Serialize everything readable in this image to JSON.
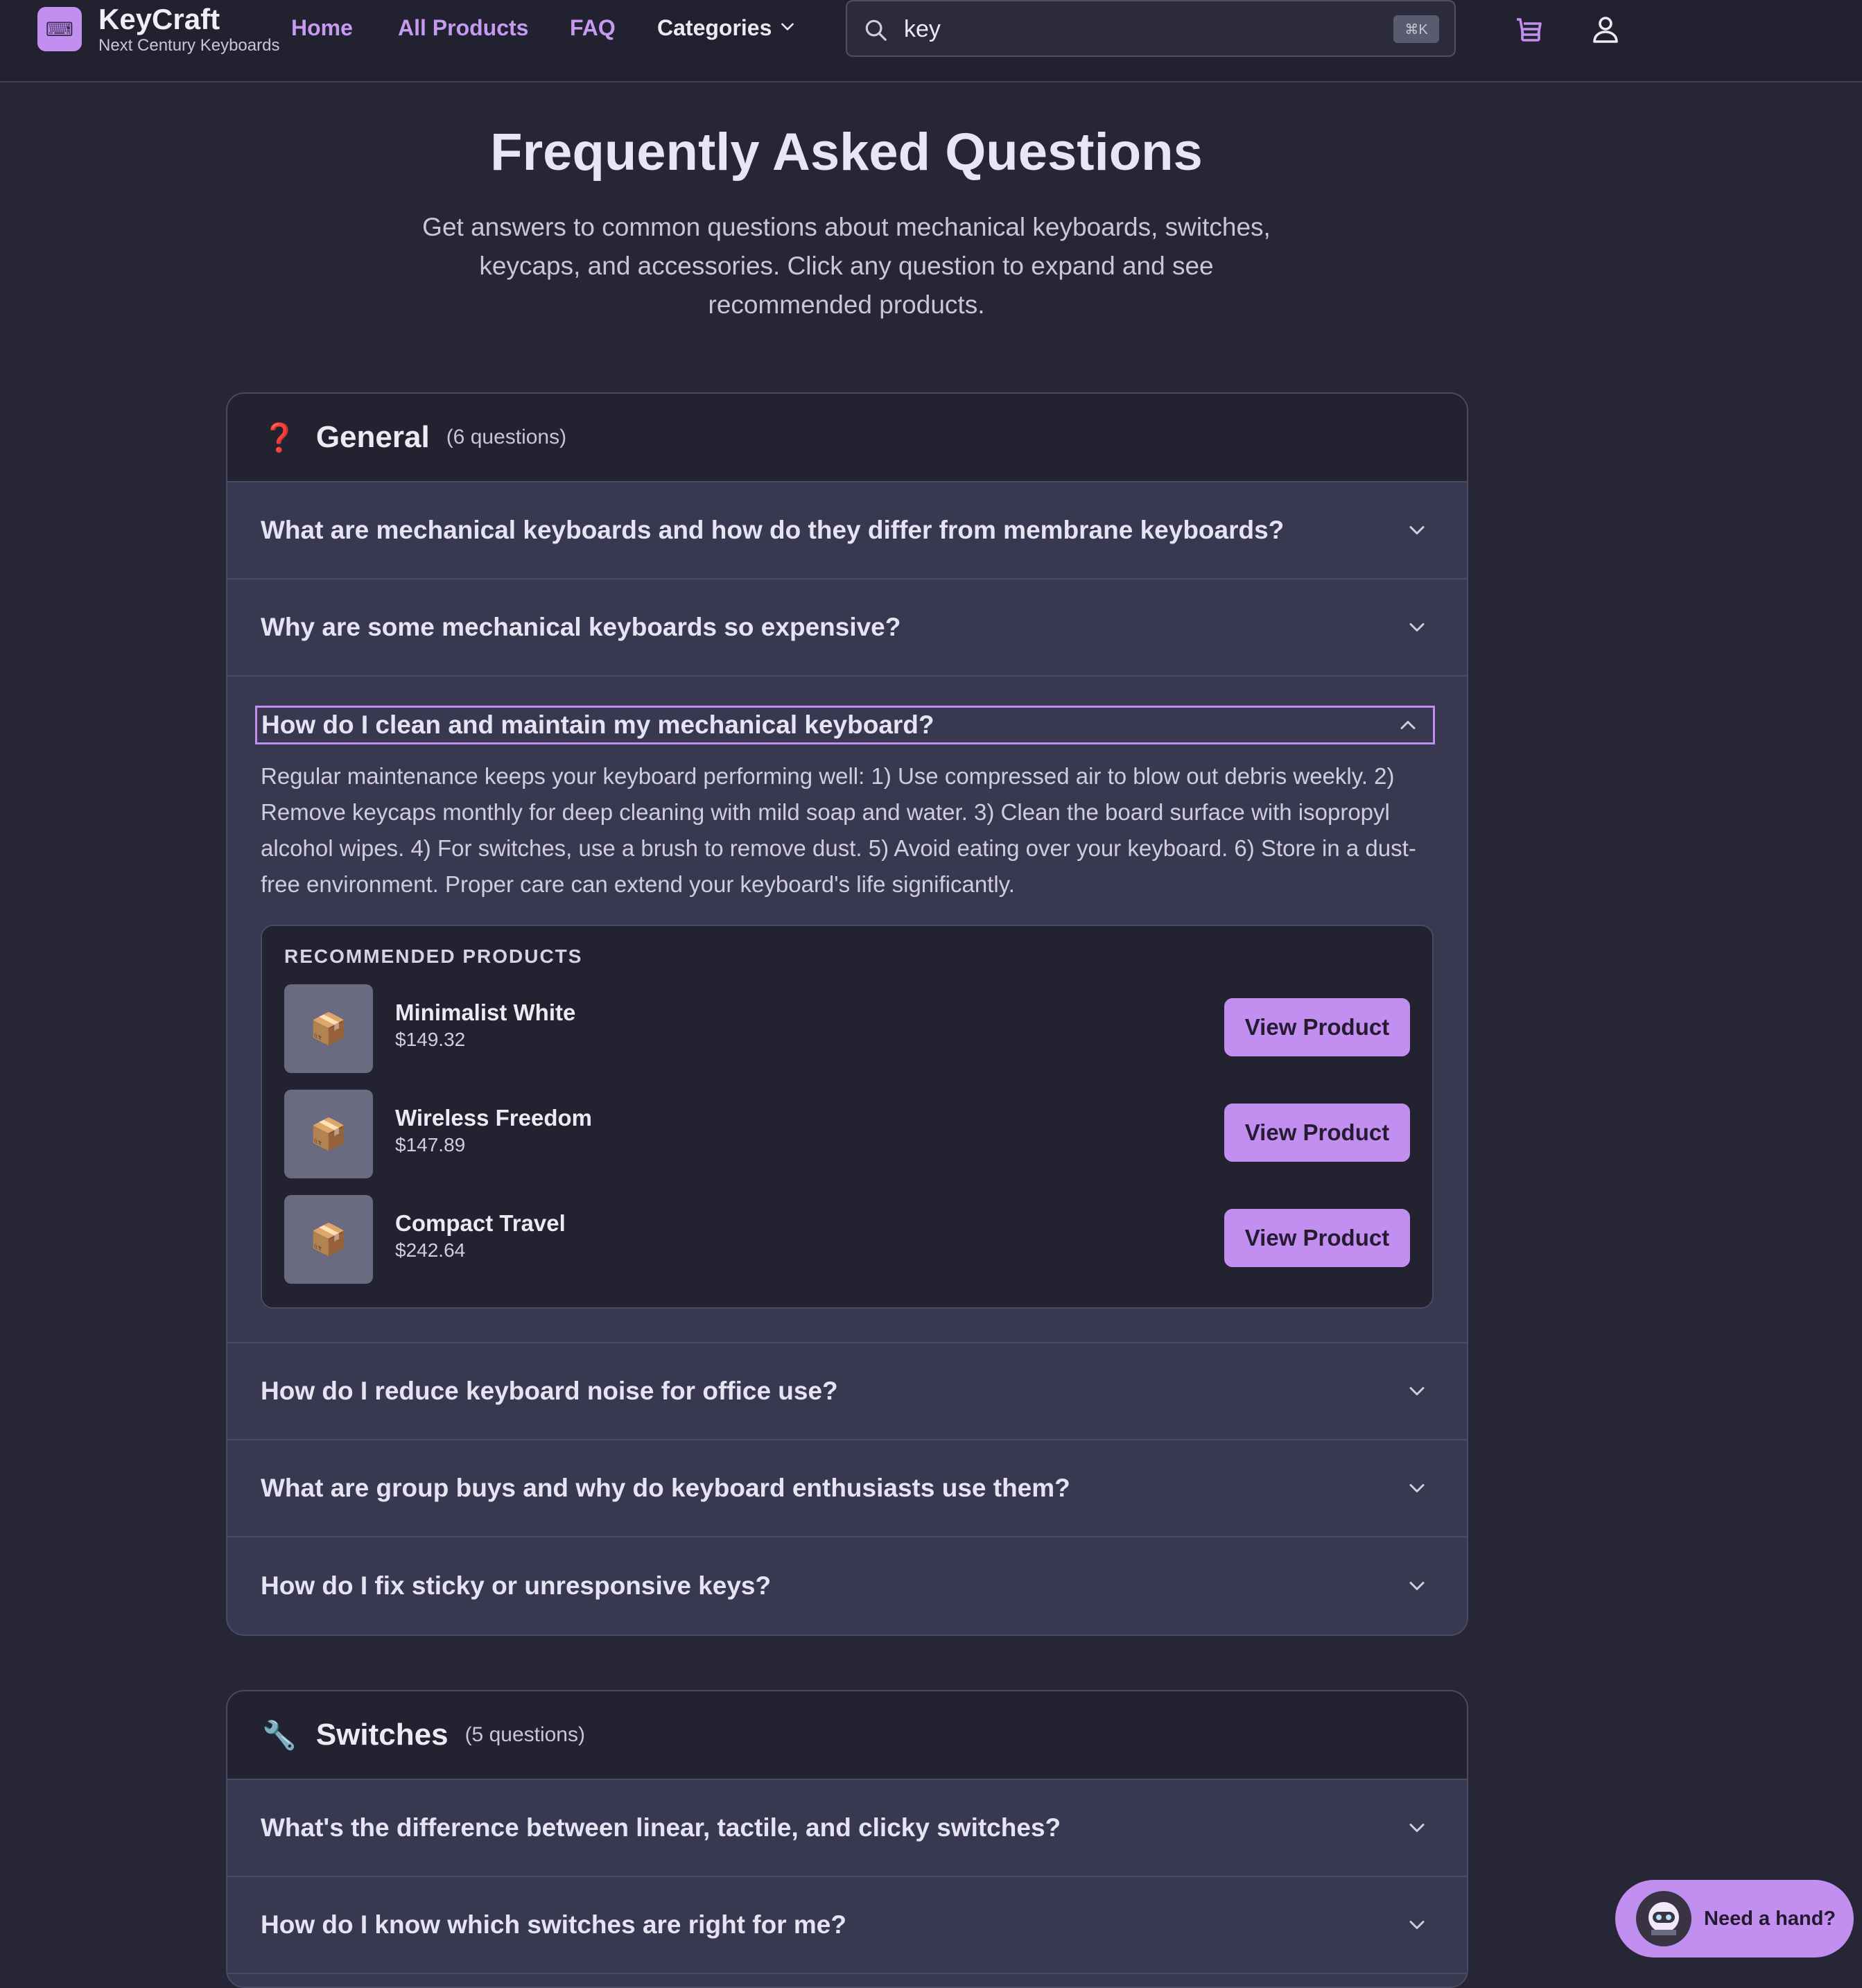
{
  "header": {
    "logo_glyph": "⌨",
    "brand_name": "KeyCraft",
    "tagline": "Next Century Keyboards",
    "nav": {
      "home": "Home",
      "all_products": "All Products",
      "faq": "FAQ",
      "categories": "Categories"
    },
    "search": {
      "value": "key",
      "shortcut": "⌘K"
    },
    "icons": [
      "search-icon",
      "cart-icon",
      "user-icon",
      "chevron-down-icon"
    ]
  },
  "hero": {
    "title": "Frequently Asked Questions",
    "subtitle": "Get answers to common questions about mechanical keyboards, switches, keycaps, and accessories. Click any question to expand and see recommended products."
  },
  "general": {
    "icon": "❓",
    "title": "General",
    "count": "(6 questions)",
    "questions": [
      "What are mechanical keyboards and how do they differ from membrane keyboards?",
      "Why are some mechanical keyboards so expensive?",
      "How do I clean and maintain my mechanical keyboard?",
      "How do I reduce keyboard noise for office use?",
      "What are group buys and why do keyboard enthusiasts use them?",
      "How do I fix sticky or unresponsive keys?"
    ],
    "open_answer": "Regular maintenance keeps your keyboard performing well: 1) Use compressed air to blow out debris weekly. 2) Remove keycaps monthly for deep cleaning with mild soap and water. 3) Clean the board surface with isopropyl alcohol wipes. 4) For switches, use a brush to remove dust. 5) Avoid eating over your keyboard. 6) Store in a dust-free environment. Proper care can extend your keyboard's life significantly.",
    "recommended": {
      "title": "RECOMMENDED PRODUCTS",
      "button_label": "View Product",
      "thumb_glyph": "📦",
      "products": [
        {
          "name": "Minimalist White",
          "price": "$149.32"
        },
        {
          "name": "Wireless Freedom",
          "price": "$147.89"
        },
        {
          "name": "Compact Travel",
          "price": "$242.64"
        }
      ]
    }
  },
  "switches": {
    "icon": "🔧",
    "title": "Switches",
    "count": "(5 questions)",
    "questions": [
      "What's the difference between linear, tactile, and clicky switches?",
      "How do I know which switches are right for me?"
    ]
  },
  "help_widget": {
    "label": "Need a hand?"
  },
  "colors": {
    "accent": "#c28ff0",
    "background": "#262637",
    "header_bg": "#21212f",
    "card_bg": "#383850"
  }
}
